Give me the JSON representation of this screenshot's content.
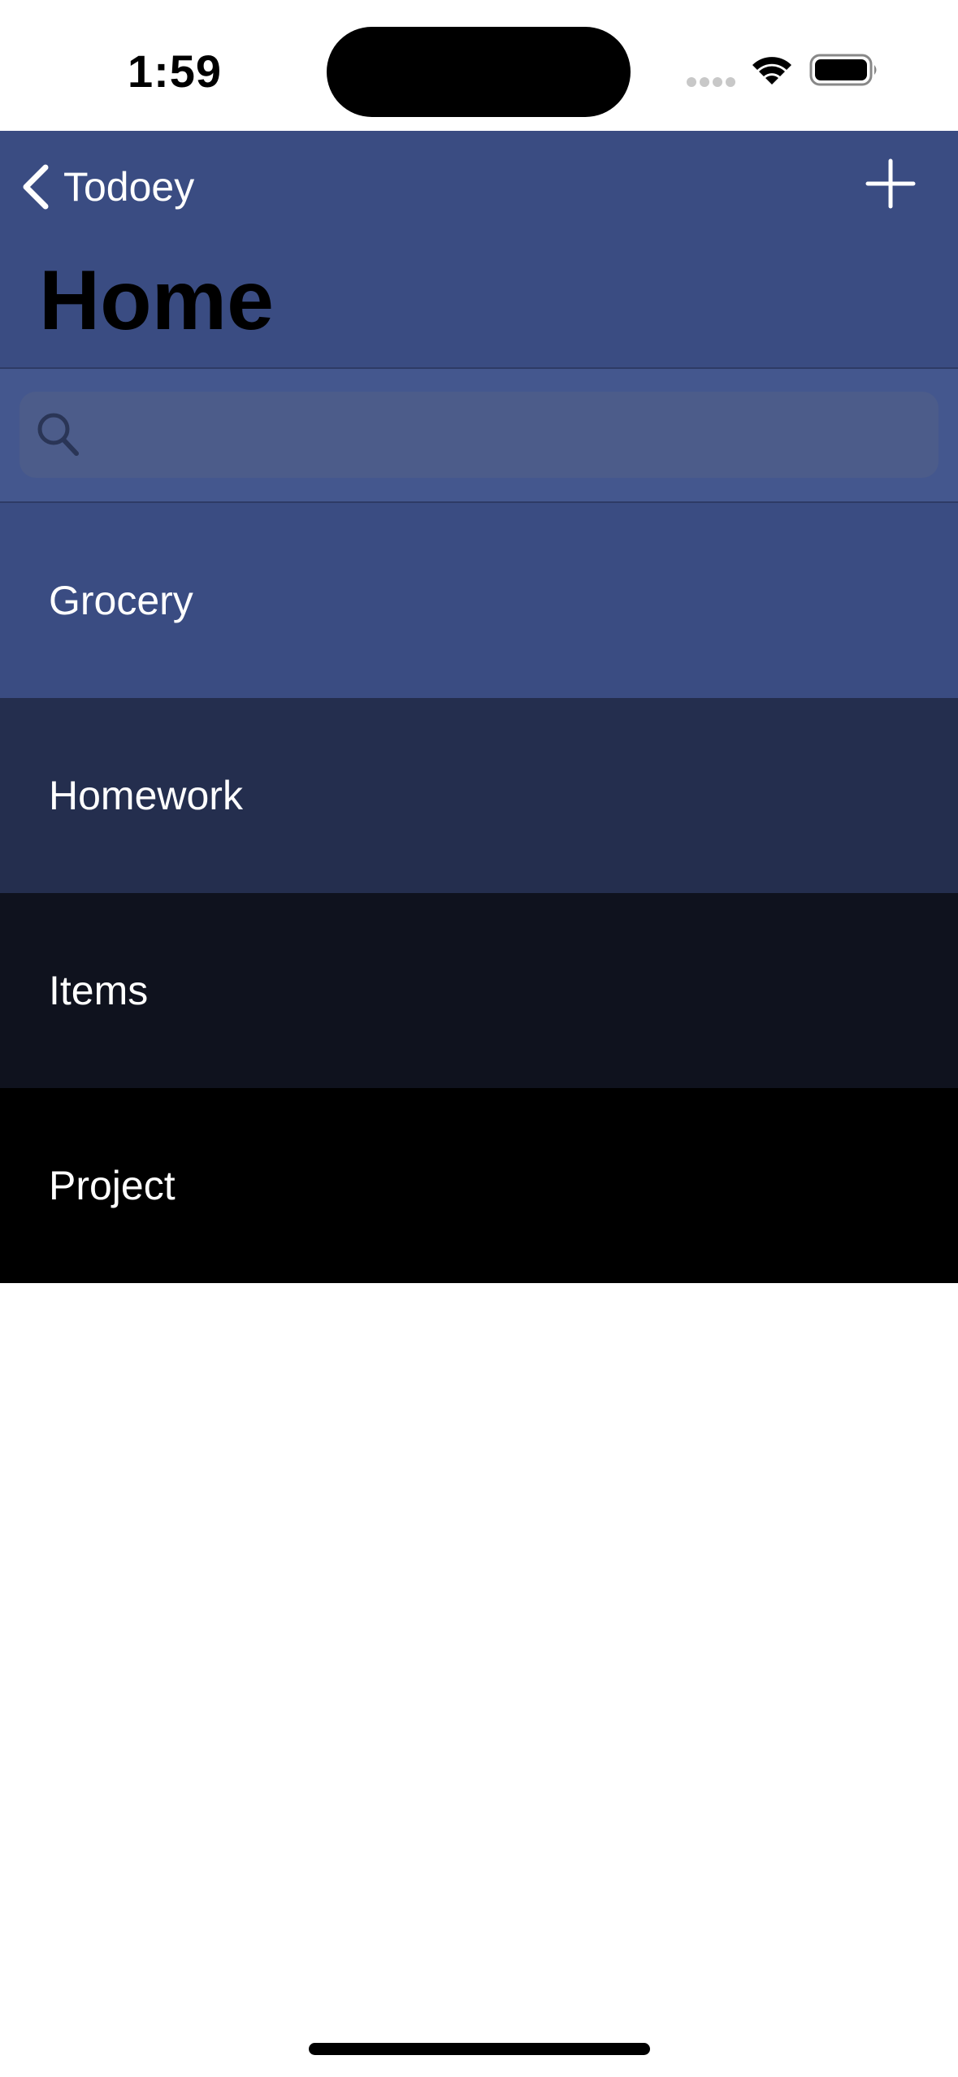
{
  "status_bar": {
    "time": "1:59"
  },
  "nav": {
    "back_label": "Todoey",
    "title": "Home"
  },
  "search": {
    "placeholder": "",
    "value": ""
  },
  "categories": [
    {
      "name": "Grocery",
      "color": "#3A4C82"
    },
    {
      "name": "Homework",
      "color": "#242E4E"
    },
    {
      "name": "Items",
      "color": "#0F121E"
    },
    {
      "name": "Project",
      "color": "#000000"
    }
  ],
  "colors": {
    "nav_background": "#3A4C82",
    "search_background": "#44578E",
    "text": "#FFFFFF"
  },
  "icons": [
    "back-chevron-icon",
    "plus-icon",
    "search-icon",
    "wifi-icon",
    "battery-icon"
  ]
}
